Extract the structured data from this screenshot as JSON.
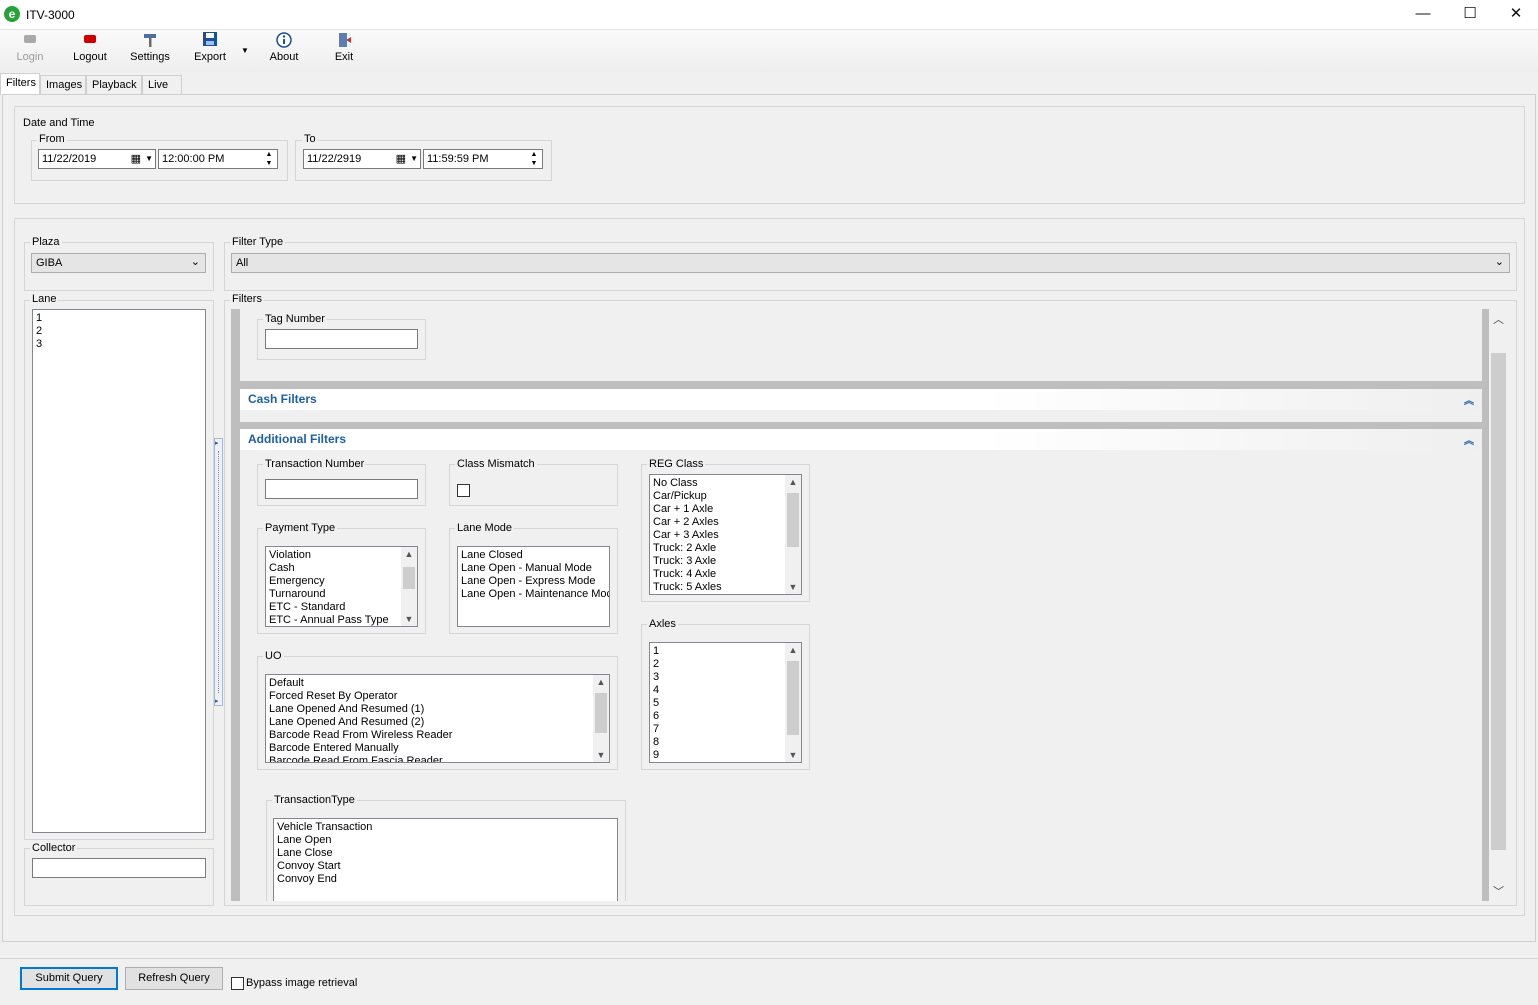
{
  "window": {
    "app_icon_letter": "e",
    "title": "ITV-3000",
    "minimize": "—",
    "maximize": "☐",
    "close": "✕"
  },
  "toolbar": {
    "login": "Login",
    "logout": "Logout",
    "settings": "Settings",
    "export": "Export",
    "about": "About",
    "exit": "Exit"
  },
  "tabs": [
    "Filters",
    "Images",
    "Playback",
    "Live"
  ],
  "date_time": {
    "group_label": "Date and Time",
    "from_label": "From",
    "from_date": "11/22/2019",
    "from_time": "12:00:00 PM",
    "to_label": "To",
    "to_date": "11/22/2919",
    "to_time": "11:59:59 PM"
  },
  "plaza": {
    "label": "Plaza",
    "value": "GIBA"
  },
  "filter_type": {
    "label": "Filter Type",
    "value": "All"
  },
  "lane": {
    "label": "Lane",
    "items": [
      "1",
      "2",
      "3"
    ]
  },
  "collector": {
    "label": "Collector",
    "value": ""
  },
  "filters": {
    "label": "Filters",
    "tag_number_label": "Tag Number",
    "cash_filters": "Cash Filters",
    "additional_filters": "Additional Filters",
    "transaction_number_label": "Transaction Number",
    "class_mismatch_label": "Class Mismatch",
    "reg_class": {
      "label": "REG Class",
      "items": [
        "No Class",
        "Car/Pickup",
        "Car + 1 Axle",
        "Car + 2 Axles",
        "Car + 3 Axles",
        "Truck: 2 Axle",
        "Truck: 3 Axle",
        "Truck: 4 Axle",
        "Truck: 5 Axles"
      ]
    },
    "payment_type": {
      "label": "Payment Type",
      "items": [
        "Violation",
        "Cash",
        "Emergency",
        "Turnaround",
        "ETC - Standard",
        "ETC - Annual Pass Type"
      ]
    },
    "lane_mode": {
      "label": "Lane Mode",
      "items": [
        "Lane Closed",
        "Lane Open - Manual Mode",
        "Lane Open - Express Mode",
        "Lane Open - Maintenance Moc"
      ]
    },
    "axles": {
      "label": "Axles",
      "items": [
        "1",
        "2",
        "3",
        "4",
        "5",
        "6",
        "7",
        "8",
        "9"
      ]
    },
    "uo": {
      "label": "UO",
      "items": [
        "Default",
        "Forced Reset By Operator",
        "Lane Opened And Resumed (1)",
        "Lane Opened And Resumed (2)",
        "Barcode Read From Wireless Reader",
        "Barcode Entered Manually",
        "Barcode Read From Fascia Reader"
      ]
    },
    "transaction_type": {
      "label": "TransactionType",
      "items": [
        "Vehicle Transaction",
        "Lane Open",
        "Lane Close",
        "Convoy Start",
        "Convoy End"
      ]
    }
  },
  "bottom": {
    "submit": "Submit Query",
    "refresh": "Refresh Query",
    "bypass": "Bypass image retrieval"
  },
  "colors": {
    "accent": "#1c5fa8",
    "focus": "#0078d7",
    "logout_red": "#d00000",
    "app_green": "#27a13a"
  }
}
